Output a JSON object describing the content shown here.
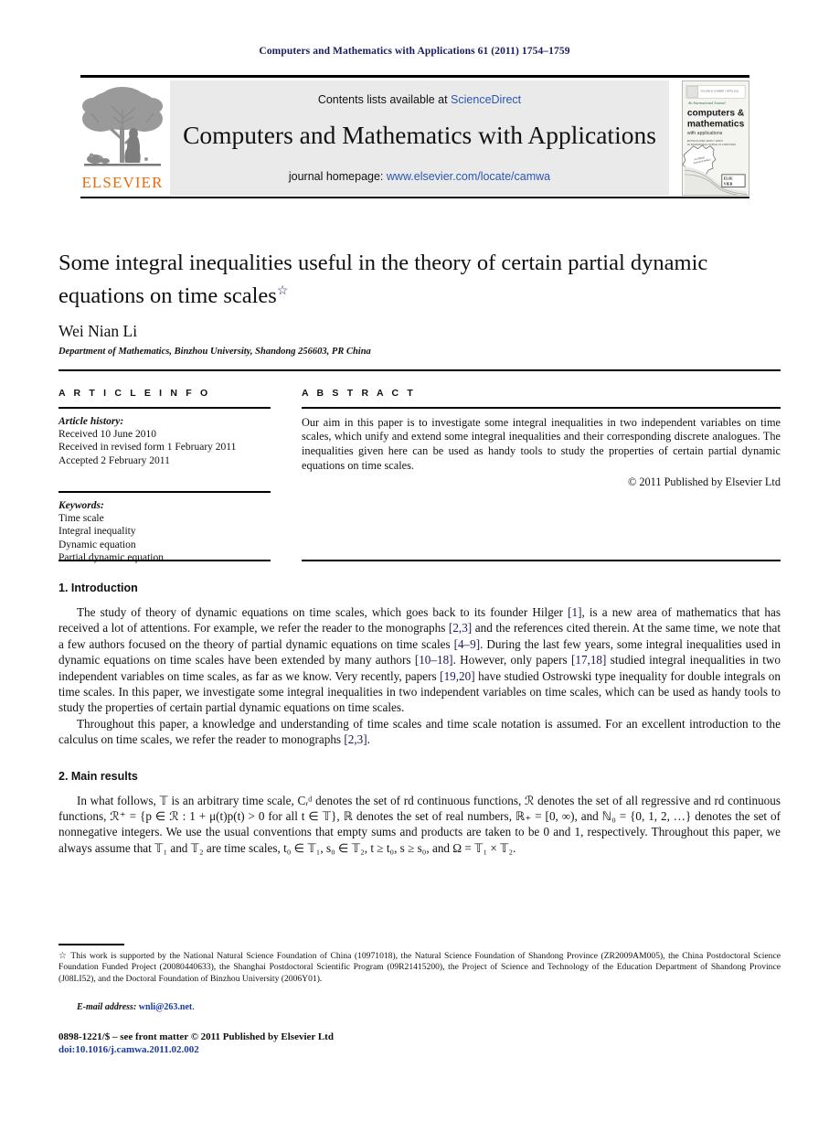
{
  "running_head": "Computers and Mathematics with Applications 61 (2011) 1754–1759",
  "masthead": {
    "contents_prefix": "Contents lists available at ",
    "contents_link": "ScienceDirect",
    "journal_title": "Computers and Mathematics with Applications",
    "homepage_prefix": "journal homepage: ",
    "homepage_link": "www.elsevier.com/locate/camwa",
    "publisher_name": "ELSEVIER",
    "publisher_logo_alt": "elsevier-tree-logo",
    "cover_alt": "journal-cover-thumbnail",
    "cover_line1": "An International Journal",
    "cover_line2": "computers &",
    "cover_line3": "mathematics",
    "cover_line4": "with applications"
  },
  "article": {
    "title": "Some integral inequalities useful in the theory of certain partial dynamic equations on time scales",
    "title_footnote_marker": "☆",
    "author": "Wei Nian Li",
    "affiliation": "Department of Mathematics, Binzhou University, Shandong 256603, PR China"
  },
  "article_info": {
    "section_label": "A R T I C L E   I N F O",
    "history_label": "Article history:",
    "history": [
      "Received 10 June 2010",
      "Received in revised form 1 February 2011",
      "Accepted 2 February 2011"
    ],
    "keywords_label": "Keywords:",
    "keywords": [
      "Time scale",
      "Integral inequality",
      "Dynamic equation",
      "Partial dynamic equation"
    ]
  },
  "abstract": {
    "section_label": "A B S T R A C T",
    "text": "Our aim in this paper is to investigate some integral inequalities in two independent variables on time scales, which unify and extend some integral inequalities and their corresponding discrete analogues. The inequalities given here can be used as handy tools to study the properties of certain partial dynamic equations on time scales.",
    "copyright": "© 2011 Published by Elsevier Ltd"
  },
  "sections": {
    "intro_heading": "1.  Introduction",
    "intro_p1": "The study of theory of dynamic equations on time scales, which goes back to its founder Hilger [1], is a new area of mathematics that has received a lot of attentions. For example, we refer the reader to the monographs [2,3] and the references cited therein. At the same time, we note that a few authors focused on the theory of partial dynamic equations on time scales [4–9]. During the last few years, some integral inequalities used in dynamic equations on time scales have been extended by many authors [10–18]. However, only papers [17,18] studied integral inequalities in two independent variables on time scales, as far as we know. Very recently, papers [19,20] have studied Ostrowski type inequality for double integrals on time scales. In this paper, we investigate some integral inequalities in two independent variables on time scales, which can be used as handy tools to study the properties of certain partial dynamic equations on time scales.",
    "intro_p2": "Throughout this paper, a knowledge and understanding of time scales and time scale notation is assumed. For an excellent introduction to the calculus on time scales, we refer the reader to monographs [2,3].",
    "results_heading": "2.  Main results",
    "results_p1": "In what follows, 𝕋 is an arbitrary time scale, Cᵣᵈ denotes the set of rd continuous functions, ℛ denotes the set of all regressive and rd continuous functions, ℛ⁺ = {p ∈ ℛ : 1 + μ(t)p(t) > 0 for all t ∈ 𝕋}, ℝ denotes the set of real numbers, ℝ₊ = [0, ∞), and ℕ₀ = {0, 1, 2, …} denotes the set of nonnegative integers. We use the usual conventions that empty sums and products are taken to be 0 and 1, respectively. Throughout this paper, we always assume that 𝕋₁ and 𝕋₂ are time scales, t₀ ∈ 𝕋₁, s₀ ∈ 𝕋₂, t ≥ t₀, s ≥ s₀, and Ω = 𝕋₁ × 𝕋₂."
  },
  "footnote": {
    "marker": "☆",
    "text": "This work is supported by the National Natural Science Foundation of China (10971018), the Natural Science Foundation of Shandong Province (ZR2009AM005), the China Postdoctoral Science Foundation Funded Project (20080440633), the Shanghai Postdoctoral Scientific Program (09R21415200), the Project of Science and Technology of the Education Department of Shandong Province (J08LI52), and the Doctoral Foundation of Binzhou University (2006Y01).",
    "email_label": "E-mail address:",
    "email": "wnli@263.net",
    "email_suffix": "."
  },
  "footer": {
    "issn_line": "0898-1221/$ – see front matter © 2011 Published by Elsevier Ltd",
    "doi_line": "doi:10.1016/j.camwa.2011.02.002"
  },
  "colors": {
    "running_head": "#1a1a5e",
    "link": "#2b56b0",
    "elsevier_orange": "#eb6a0a",
    "band_bg": "#eaeaea",
    "citation": "#1a1a5e",
    "doi": "#1a3a9e"
  }
}
